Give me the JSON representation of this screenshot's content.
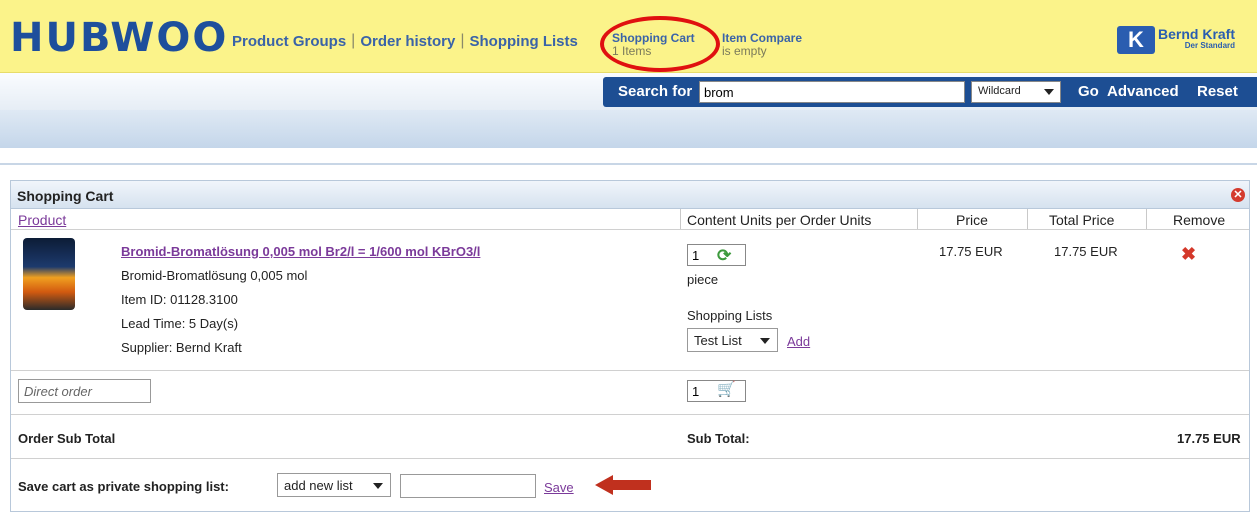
{
  "header": {
    "logo": "HUBWOO",
    "nav": [
      "Product Groups",
      "Order history",
      "Shopping Lists"
    ],
    "cart": {
      "title": "Shopping Cart",
      "status": "1 Items"
    },
    "compare": {
      "title": "Item Compare",
      "status": "is empty"
    },
    "brand": {
      "mark": "K",
      "name": "Bernd Kraft",
      "sub": "Der Standard"
    }
  },
  "search": {
    "label": "Search for",
    "value": "brom",
    "mode": "Wildcard",
    "buttons": [
      "Go",
      "Advanced",
      "Reset"
    ]
  },
  "cart": {
    "title": "Shopping Cart",
    "columns": {
      "product": "Product",
      "units": "Content Units per Order Units",
      "price": "Price",
      "total": "Total Price",
      "remove": "Remove"
    },
    "item": {
      "name": "Bromid-Bromatlösung 0,005 mol Br2/l = 1/600 mol KBrO3/l",
      "description": "Bromid-Bromatlösung 0,005 mol",
      "item_id": "Item ID: 01128.3100",
      "lead_time": "Lead Time: 5 Day(s)",
      "supplier": "Supplier: Bernd Kraft",
      "quantity": "1",
      "unit": "piece",
      "lists_label": "Shopping Lists",
      "list_selected": "Test List",
      "add_label": "Add",
      "price": "17.75 EUR",
      "total": "17.75 EUR"
    },
    "direct_order": {
      "placeholder": "Direct order",
      "quantity": "1"
    },
    "subtotal": {
      "label": "Order Sub Total",
      "sub_label": "Sub Total:",
      "value": "17.75 EUR"
    },
    "save": {
      "label": "Save cart as private shopping list:",
      "select": "add new list",
      "button": "Save"
    }
  },
  "colors": {
    "header_bg": "#fbf38a",
    "search_bg": "#1d4e93",
    "link": "#7b3a9a",
    "highlight": "#e01010"
  }
}
